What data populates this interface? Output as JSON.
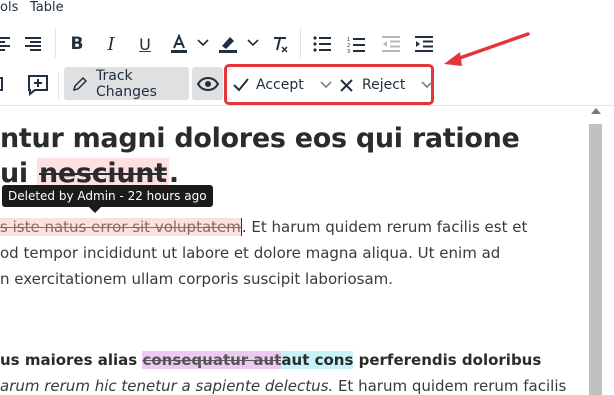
{
  "menubar": {
    "tools_partial": "ols",
    "table": "Table"
  },
  "toolbar": {
    "track_changes_label": "Track Changes",
    "accept_label": "Accept",
    "reject_label": "Reject"
  },
  "editor": {
    "heading_line1": "ntur magni dolores eos qui ratione",
    "heading_line2_prefix": "ui ",
    "heading_line2_deleted": "nesciunt",
    "heading_line2_suffix": ".",
    "tooltip": "Deleted by Admin - 22 hours ago",
    "para1_line1_deleted": "s iste natus error sit voluptatem",
    "para1_line1_rest": ". Et harum quidem rerum facilis est et",
    "para1_line2": "od tempor incididunt ut labore et dolore magna aliqua. Ut enim ad",
    "para1_line3": "n exercitationem ullam corporis suscipit laboriosam.",
    "para2_prefix": "us maiores alias ",
    "para2_deleted": "consequatur aut",
    "para2_inserted": "aut cons",
    "para2_suffix": " perferendis doloribus",
    "para3_italic": "arum rerum hic tenetur a sapiente delectus.",
    "para3_rest": " Et harum quidem rerum facilis"
  },
  "colors": {
    "highlight_border": "#e2363b",
    "deleted_bg": "#fde0e0",
    "deleted_purple_bg": "#eccaf2",
    "inserted_bg": "#c6f3f8"
  }
}
